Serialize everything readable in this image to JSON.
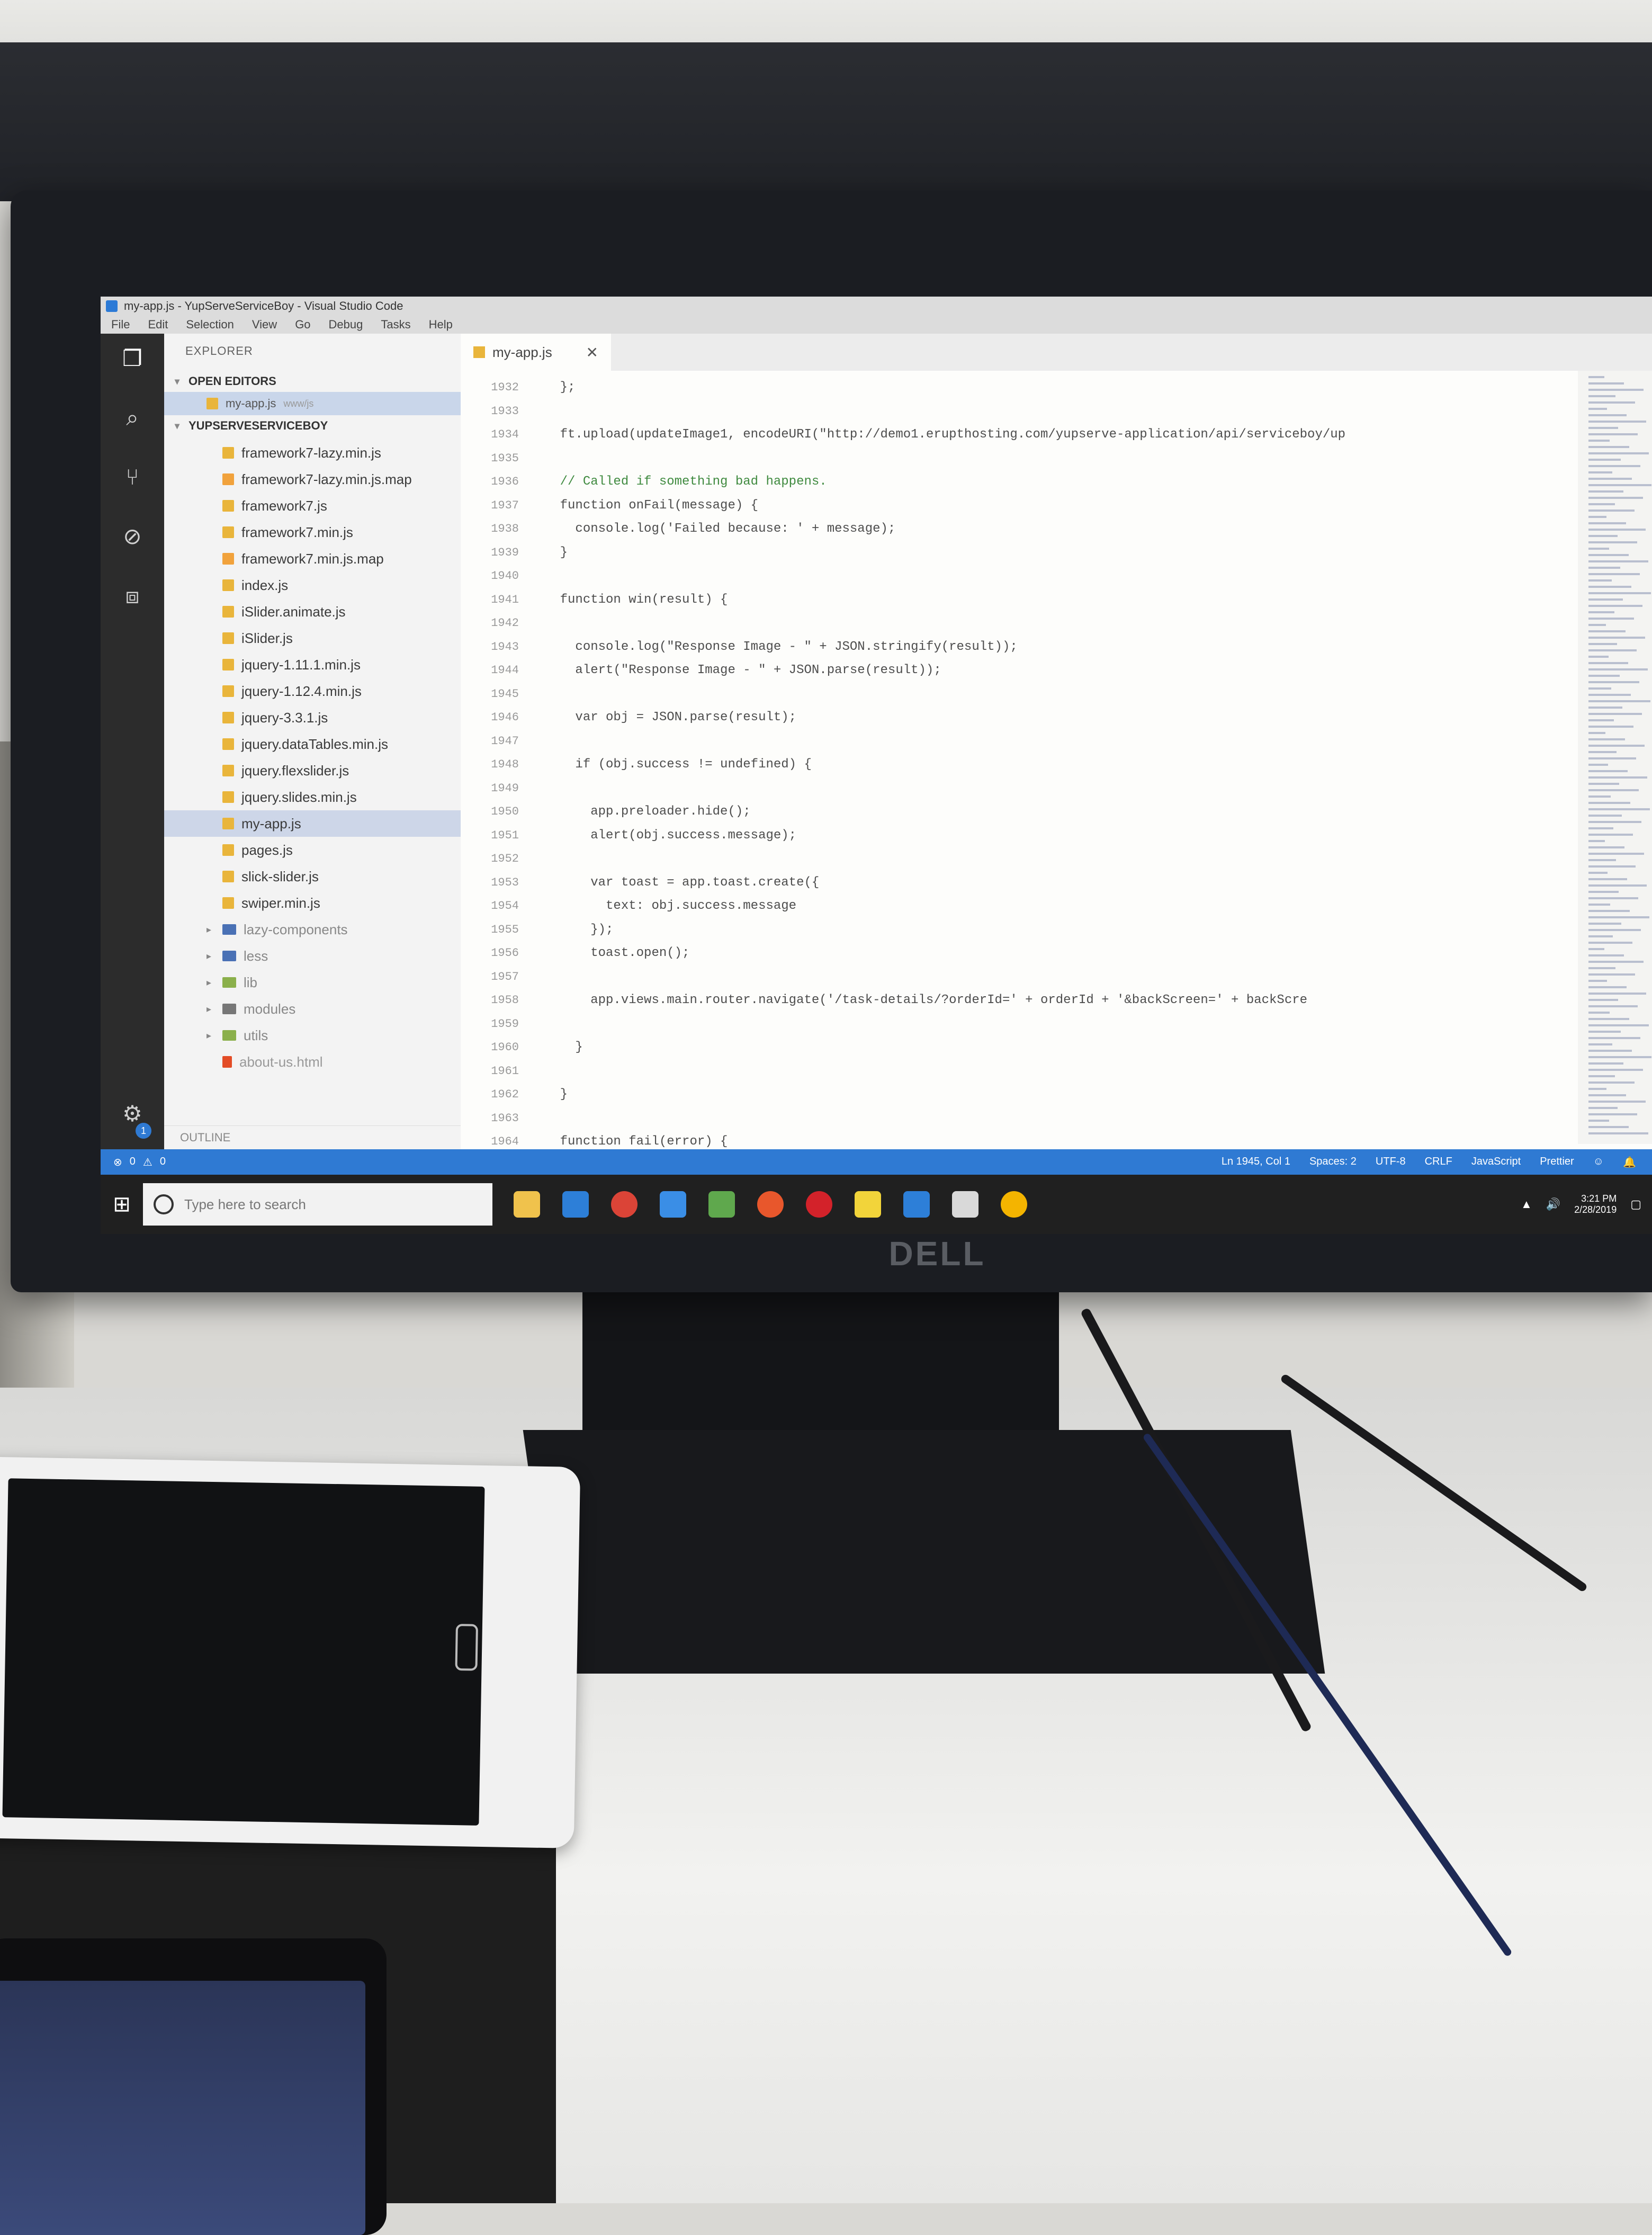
{
  "window": {
    "title": "my-app.js - YupServeServiceBoy - Visual Studio Code"
  },
  "menu": [
    "File",
    "Edit",
    "Selection",
    "View",
    "Go",
    "Debug",
    "Tasks",
    "Help"
  ],
  "sidebar": {
    "title": "EXPLORER",
    "open_editors_label": "OPEN EDITORS",
    "open_editor_file": "my-app.js",
    "open_editor_path": "www/js",
    "project_label": "YUPSERVESERVICEBOY",
    "files": [
      "framework7-lazy.min.js",
      "framework7-lazy.min.js.map",
      "framework7.js",
      "framework7.min.js",
      "framework7.min.js.map",
      "index.js",
      "iSlider.animate.js",
      "iSlider.js",
      "jquery-1.11.1.min.js",
      "jquery-1.12.4.min.js",
      "jquery-3.3.1.js",
      "jquery.dataTables.min.js",
      "jquery.flexslider.js",
      "jquery.slides.min.js",
      "my-app.js",
      "pages.js",
      "slick-slider.js",
      "swiper.min.js"
    ],
    "selected_file": "my-app.js",
    "folders": [
      "lazy-components",
      "less",
      "lib",
      "modules",
      "utils"
    ],
    "html_file": "about-us.html",
    "outline_label": "OUTLINE"
  },
  "editor": {
    "tab_label": "my-app.js",
    "line_numbers": [
      "1932",
      "1933",
      "1934",
      "1935",
      "1936",
      "1937",
      "1938",
      "1939",
      "1940",
      "1941",
      "1942",
      "1943",
      "1944",
      "1945",
      "1946",
      "1947",
      "1948",
      "1949",
      "1950",
      "1951",
      "1952",
      "1953",
      "1954",
      "1955",
      "1956",
      "1957",
      "1958",
      "1959",
      "1960",
      "1961",
      "1962",
      "1963",
      "1964"
    ],
    "lines": [
      "    };",
      "",
      "    ft.upload(updateImage1, encodeURI(\"http://demo1.erupthosting.com/yupserve-application/api/serviceboy/up",
      "",
      "    // Called if something bad happens.",
      "    function onFail(message) {",
      "      console.log('Failed because: ' + message);",
      "    }",
      "",
      "    function win(result) {",
      "",
      "      console.log(\"Response Image - \" + JSON.stringify(result));",
      "      alert(\"Response Image - \" + JSON.parse(result));",
      "",
      "      var obj = JSON.parse(result);",
      "",
      "      if (obj.success != undefined) {",
      "",
      "        app.preloader.hide();",
      "        alert(obj.success.message);",
      "",
      "        var toast = app.toast.create({",
      "          text: obj.success.message",
      "        });",
      "        toast.open();",
      "",
      "        app.views.main.router.navigate('/task-details/?orderId=' + orderId + '&backScreen=' + backScre",
      "",
      "      }",
      "",
      "    }",
      "",
      "    function fail(error) {"
    ]
  },
  "status": {
    "errors": "0",
    "warnings": "0",
    "position": "Ln 1945, Col 1",
    "spaces": "Spaces: 2",
    "encoding": "UTF-8",
    "eol": "CRLF",
    "language": "JavaScript",
    "formatter": "Prettier"
  },
  "taskbar": {
    "search_placeholder": "Type here to search",
    "time": "3:21 PM",
    "date": "2/28/2019"
  },
  "monitor_brand": "DELL",
  "badge_count": "1"
}
